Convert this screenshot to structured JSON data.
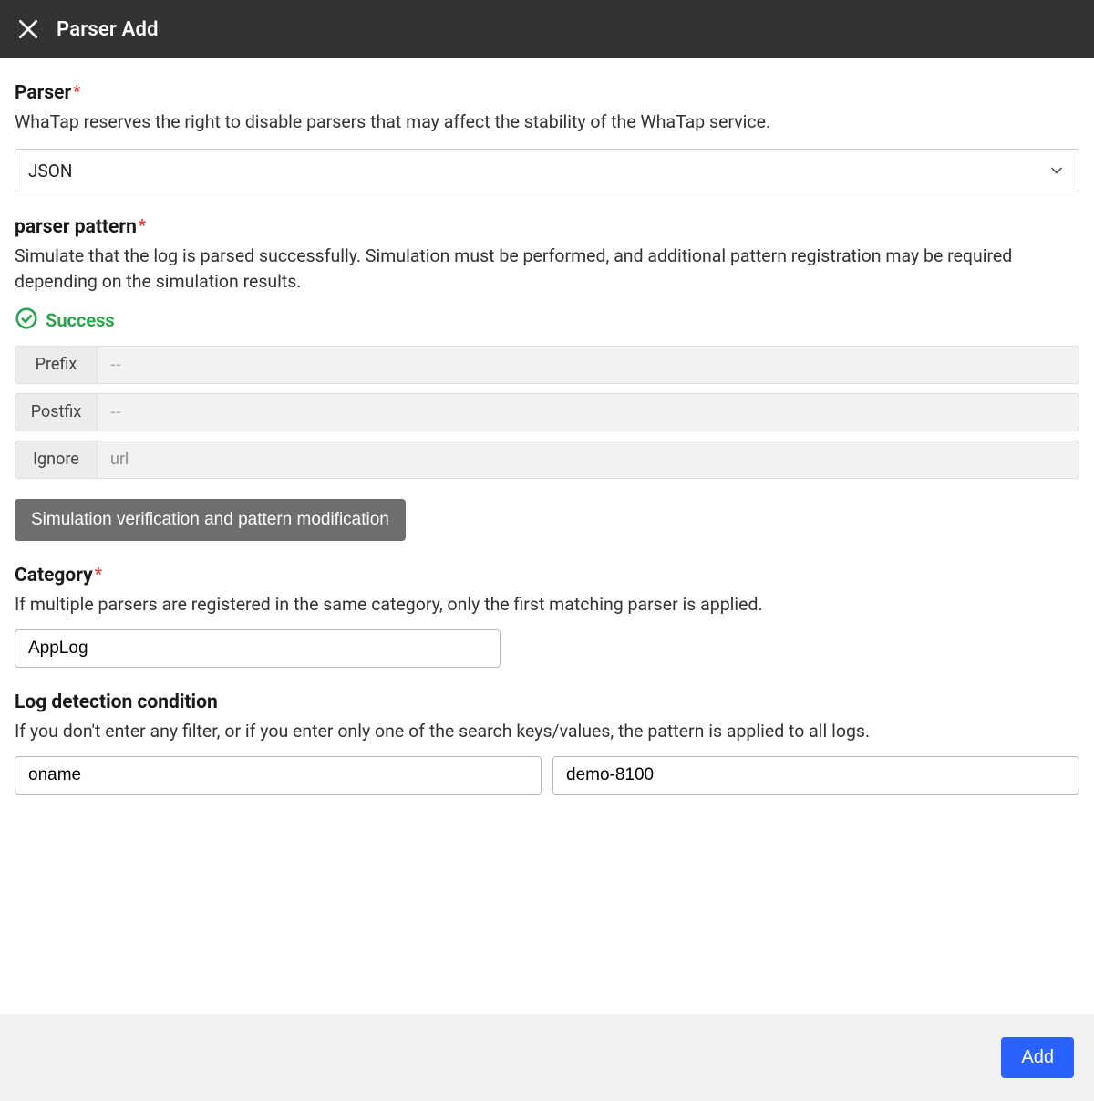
{
  "header": {
    "title": "Parser Add"
  },
  "parser": {
    "label": "Parser",
    "required": "*",
    "desc": "WhaTap reserves the right to disable parsers that may affect the stability of the WhaTap service.",
    "selected": "JSON"
  },
  "pattern": {
    "label": "parser pattern",
    "required": "*",
    "desc": "Simulate that the log is parsed successfully. Simulation must be performed, and additional pattern registration may be required depending on the simulation results.",
    "status_text": "Success",
    "rows": {
      "prefix": {
        "label": "Prefix",
        "placeholder": "--",
        "value": ""
      },
      "postfix": {
        "label": "Postfix",
        "placeholder": "--",
        "value": ""
      },
      "ignore": {
        "label": "Ignore",
        "placeholder": "url",
        "value": "url"
      }
    },
    "sim_button": "Simulation verification and pattern modification"
  },
  "category": {
    "label": "Category",
    "required": "*",
    "desc": "If multiple parsers are registered in the same category, only the first matching parser is applied.",
    "value": "AppLog"
  },
  "detection": {
    "label": "Log detection condition",
    "desc": "If you don't enter any filter, or if you enter only one of the search keys/values, the pattern is applied to all logs.",
    "key": "oname",
    "value": "demo-8100"
  },
  "footer": {
    "add": "Add"
  }
}
